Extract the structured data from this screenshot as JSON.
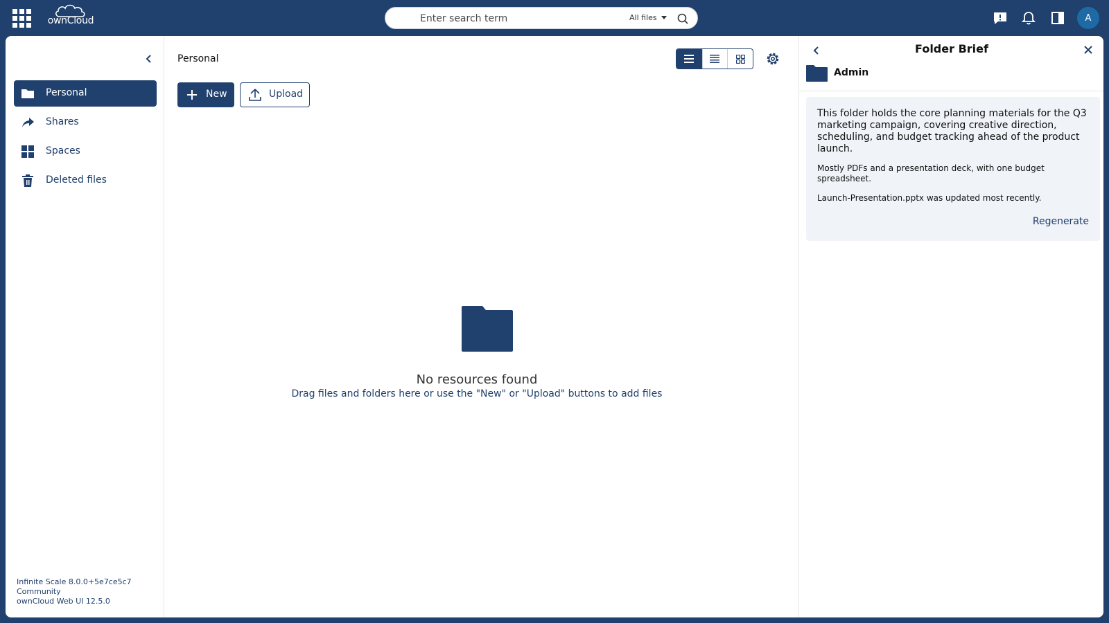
{
  "topbar": {
    "logo_text": "ownCloud",
    "search_placeholder": "Enter search term",
    "search_scope": "All files",
    "avatar_initial": "A"
  },
  "sidebar": {
    "items": [
      {
        "label": "Personal",
        "icon": "folder-icon",
        "active": true
      },
      {
        "label": "Shares",
        "icon": "share-icon",
        "active": false
      },
      {
        "label": "Spaces",
        "icon": "spaces-grid-icon",
        "active": false
      },
      {
        "label": "Deleted files",
        "icon": "trash-icon",
        "active": false
      }
    ],
    "version": {
      "line1": "Infinite Scale 8.0.0+5e7ce5c7",
      "line2": "Community",
      "line3": "ownCloud Web UI 12.5.0"
    }
  },
  "content": {
    "breadcrumb": "Personal",
    "new_label": "New",
    "upload_label": "Upload",
    "empty_title": "No resources found",
    "empty_subtitle": "Drag files and folders here or use the \"New\" or \"Upload\" buttons to add files"
  },
  "panel": {
    "title": "Folder Brief",
    "folder_name": "Admin",
    "summary": "This folder holds the core planning materials for the Q3 marketing campaign, covering creative direction, scheduling, and budget tracking ahead of the product launch.",
    "composition": "Mostly PDFs and a presentation deck, with one budget spreadsheet.",
    "recent": "Launch-Presentation.pptx was updated most recently.",
    "regenerate_label": "Regenerate"
  },
  "colors": {
    "brand": "#20406d",
    "panel_bg": "#f0f3f8",
    "avatar": "#1d6aa5"
  }
}
